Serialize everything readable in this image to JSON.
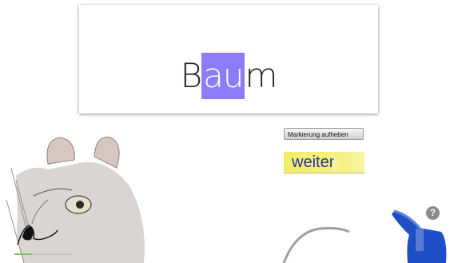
{
  "word": {
    "prefix": "B",
    "highlight": "au",
    "suffix": "m"
  },
  "buttons": {
    "clear_marking": "Markierung aufheben",
    "next": "weiter"
  },
  "help": {
    "label": "?"
  },
  "colors": {
    "highlight": "#8c7cf7",
    "next_button": "#f2ee6a",
    "next_text": "#2a2fa3"
  }
}
